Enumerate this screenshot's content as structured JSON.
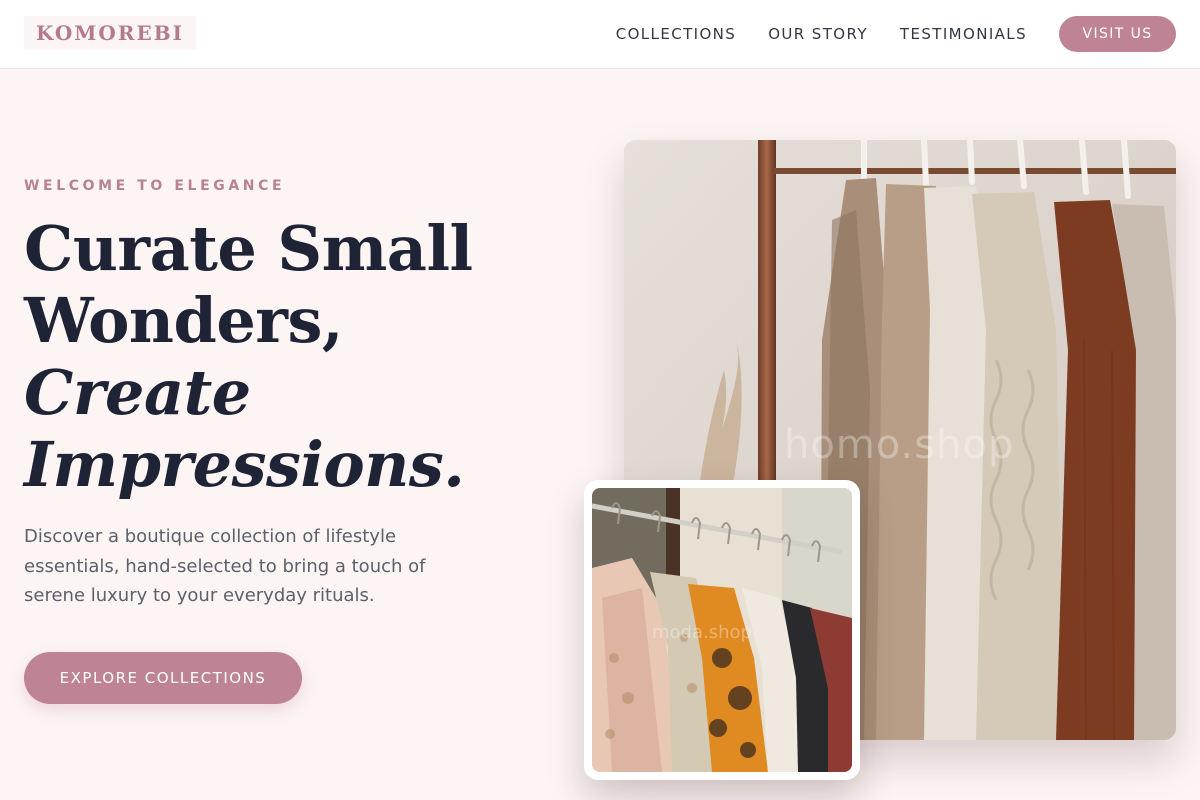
{
  "header": {
    "brand": "KOMOREBI",
    "nav": [
      {
        "label": "COLLECTIONS"
      },
      {
        "label": "OUR STORY"
      },
      {
        "label": "TESTIMONIALS"
      }
    ],
    "visit_label": "VISIT US"
  },
  "hero": {
    "eyebrow": "WELCOME TO ELEGANCE",
    "headline": {
      "line1": "Curate Small",
      "line2": "Wonders,",
      "line3": "Create",
      "line4": "Impressions."
    },
    "lead": "Discover a boutique collection of lifestyle essentials, hand-selected to bring a touch of serene luxury to your everyday rituals.",
    "cta_label": "EXPLORE COLLECTIONS",
    "main_watermark": "homo.shop",
    "inset_watermark": "moda.shop"
  },
  "colors": {
    "accent": "#bf8493",
    "background": "#fdf4f4",
    "heading": "#1e2335"
  },
  "icons": [
    "clothing-rack-photo",
    "dress-rack-photo"
  ]
}
